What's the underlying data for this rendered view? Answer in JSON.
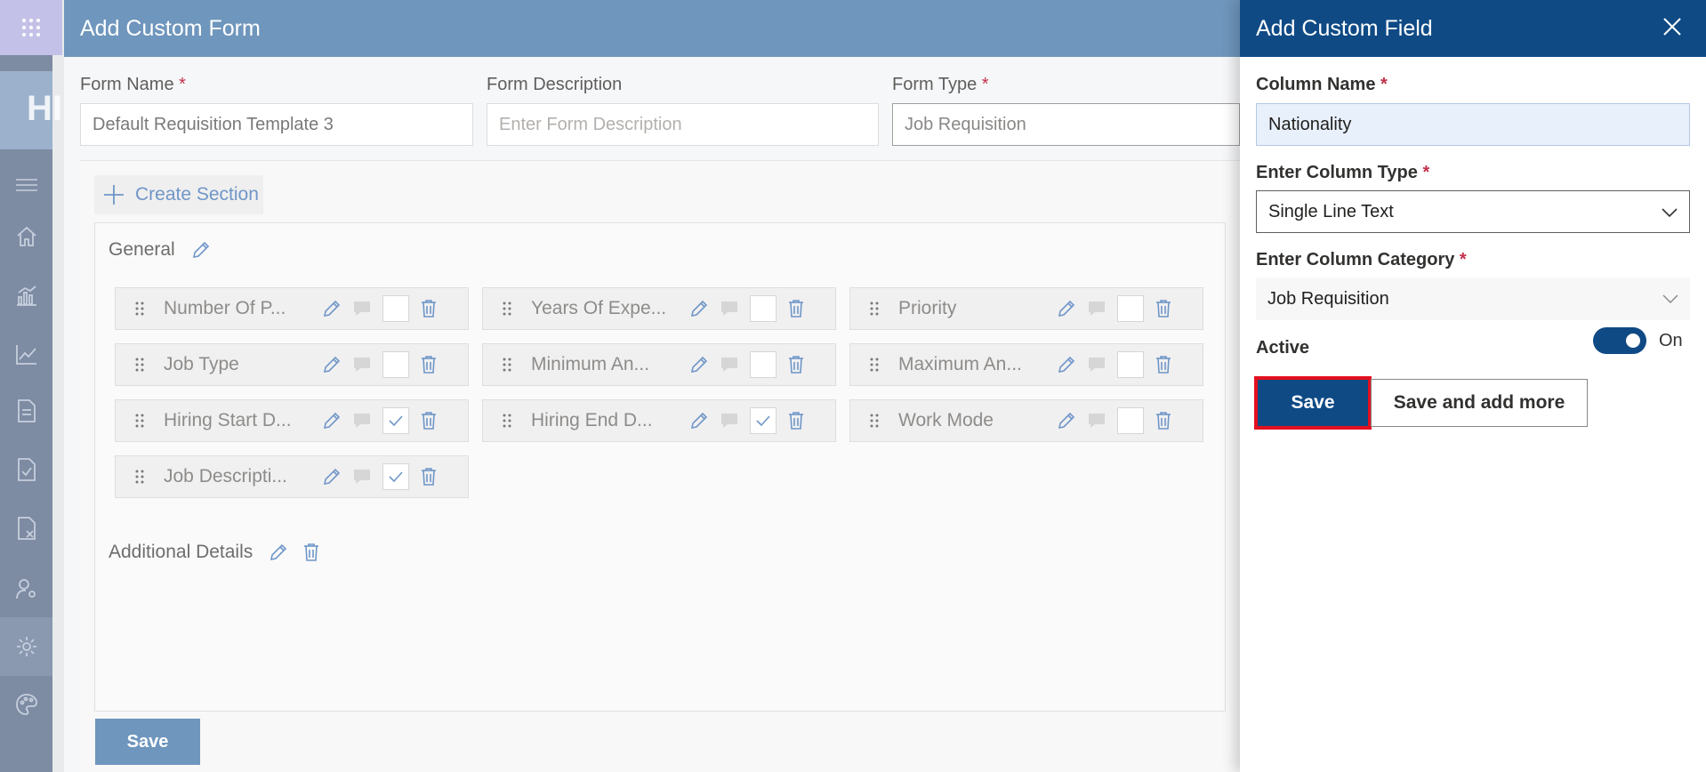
{
  "rail": {
    "logo_text": "HI",
    "icons": [
      "menu-icon",
      "home-icon",
      "bar-chart-icon",
      "line-chart-icon",
      "document-icon",
      "document-check-icon",
      "document-x-icon",
      "user-settings-icon",
      "gear-icon",
      "palette-icon"
    ]
  },
  "main": {
    "title": "Add Custom Form",
    "form_name": {
      "label": "Form Name",
      "required": "*",
      "value": "Default Requisition Template 3"
    },
    "form_description": {
      "label": "Form Description",
      "placeholder": "Enter Form Description"
    },
    "form_type": {
      "label": "Form Type",
      "required": "*",
      "value": "Job Requisition"
    },
    "create_section_label": "Create Section",
    "sections": [
      {
        "title": "General",
        "fields": [
          {
            "name": "Number Of P...",
            "checked": false
          },
          {
            "name": "Years Of Expe...",
            "checked": false
          },
          {
            "name": "Priority",
            "checked": false
          },
          {
            "name": "Job Type",
            "checked": false
          },
          {
            "name": "Minimum An...",
            "checked": false
          },
          {
            "name": "Maximum An...",
            "checked": false
          },
          {
            "name": "Hiring Start D...",
            "checked": true
          },
          {
            "name": "Hiring End D...",
            "checked": true
          },
          {
            "name": "Work Mode",
            "checked": false
          },
          {
            "name": "Job Descripti...",
            "checked": true
          }
        ]
      },
      {
        "title": "Additional Details",
        "fields": []
      }
    ],
    "save_label": "Save"
  },
  "flyout": {
    "title": "Add Custom Field",
    "column_name": {
      "label": "Column Name",
      "required": "*",
      "value": "Nationality"
    },
    "column_type": {
      "label": "Enter Column Type",
      "required": "*",
      "value": "Single Line Text"
    },
    "column_category": {
      "label": "Enter Column Category",
      "required": "*",
      "value": "Job Requisition"
    },
    "active": {
      "label": "Active",
      "state_label": "On",
      "on": true
    },
    "save_label": "Save",
    "save_more_label": "Save and add more"
  },
  "colors": {
    "primary": "#0f4a85",
    "header_dim": "#6f96bd",
    "highlight": "#e3101f",
    "required": "#c4314b"
  }
}
